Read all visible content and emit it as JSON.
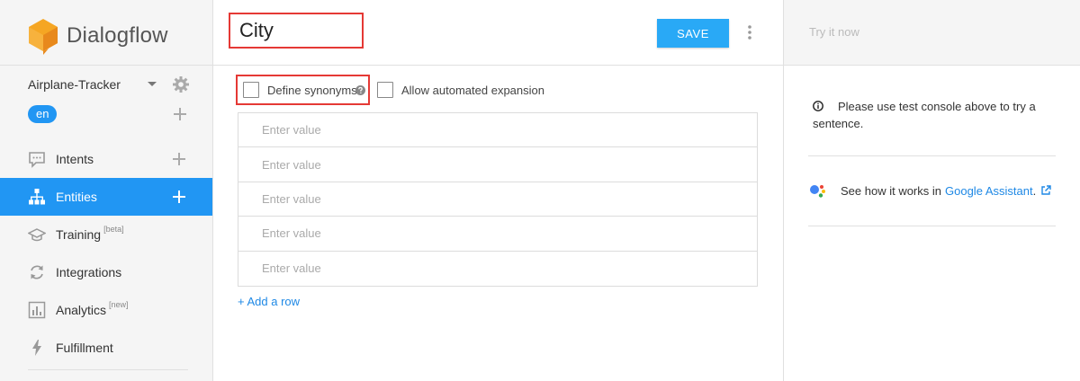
{
  "brand": {
    "name": "Dialogflow",
    "color": "#f5a623"
  },
  "agent": {
    "name": "Airplane-Tracker",
    "language": "en"
  },
  "nav": {
    "items": [
      {
        "label": "Intents",
        "sup": "",
        "icon": "chat-bubble-icon"
      },
      {
        "label": "Entities",
        "sup": "",
        "icon": "hierarchy-icon"
      },
      {
        "label": "Training",
        "sup": "[beta]",
        "icon": "graduation-cap-icon"
      },
      {
        "label": "Integrations",
        "sup": "",
        "icon": "sync-icon"
      },
      {
        "label": "Analytics",
        "sup": "[new]",
        "icon": "bar-chart-icon"
      },
      {
        "label": "Fulfillment",
        "sup": "",
        "icon": "lightning-icon"
      }
    ]
  },
  "entity": {
    "name": "City",
    "save_label": "SAVE",
    "define_synonyms_label": "Define synonyms",
    "allow_expansion_label": "Allow automated expansion",
    "value_placeholder": "Enter value",
    "add_row_label": "+ Add a row"
  },
  "test_panel": {
    "try_placeholder": "Try it now",
    "info_text": "Please use test console above to try a sentence.",
    "ga_prefix": "See how it works in",
    "ga_link": "Google Assistant",
    "ga_suffix": "."
  },
  "colors": {
    "accent": "#2196f3",
    "save": "#29a9f6",
    "highlight": "#e53935"
  }
}
